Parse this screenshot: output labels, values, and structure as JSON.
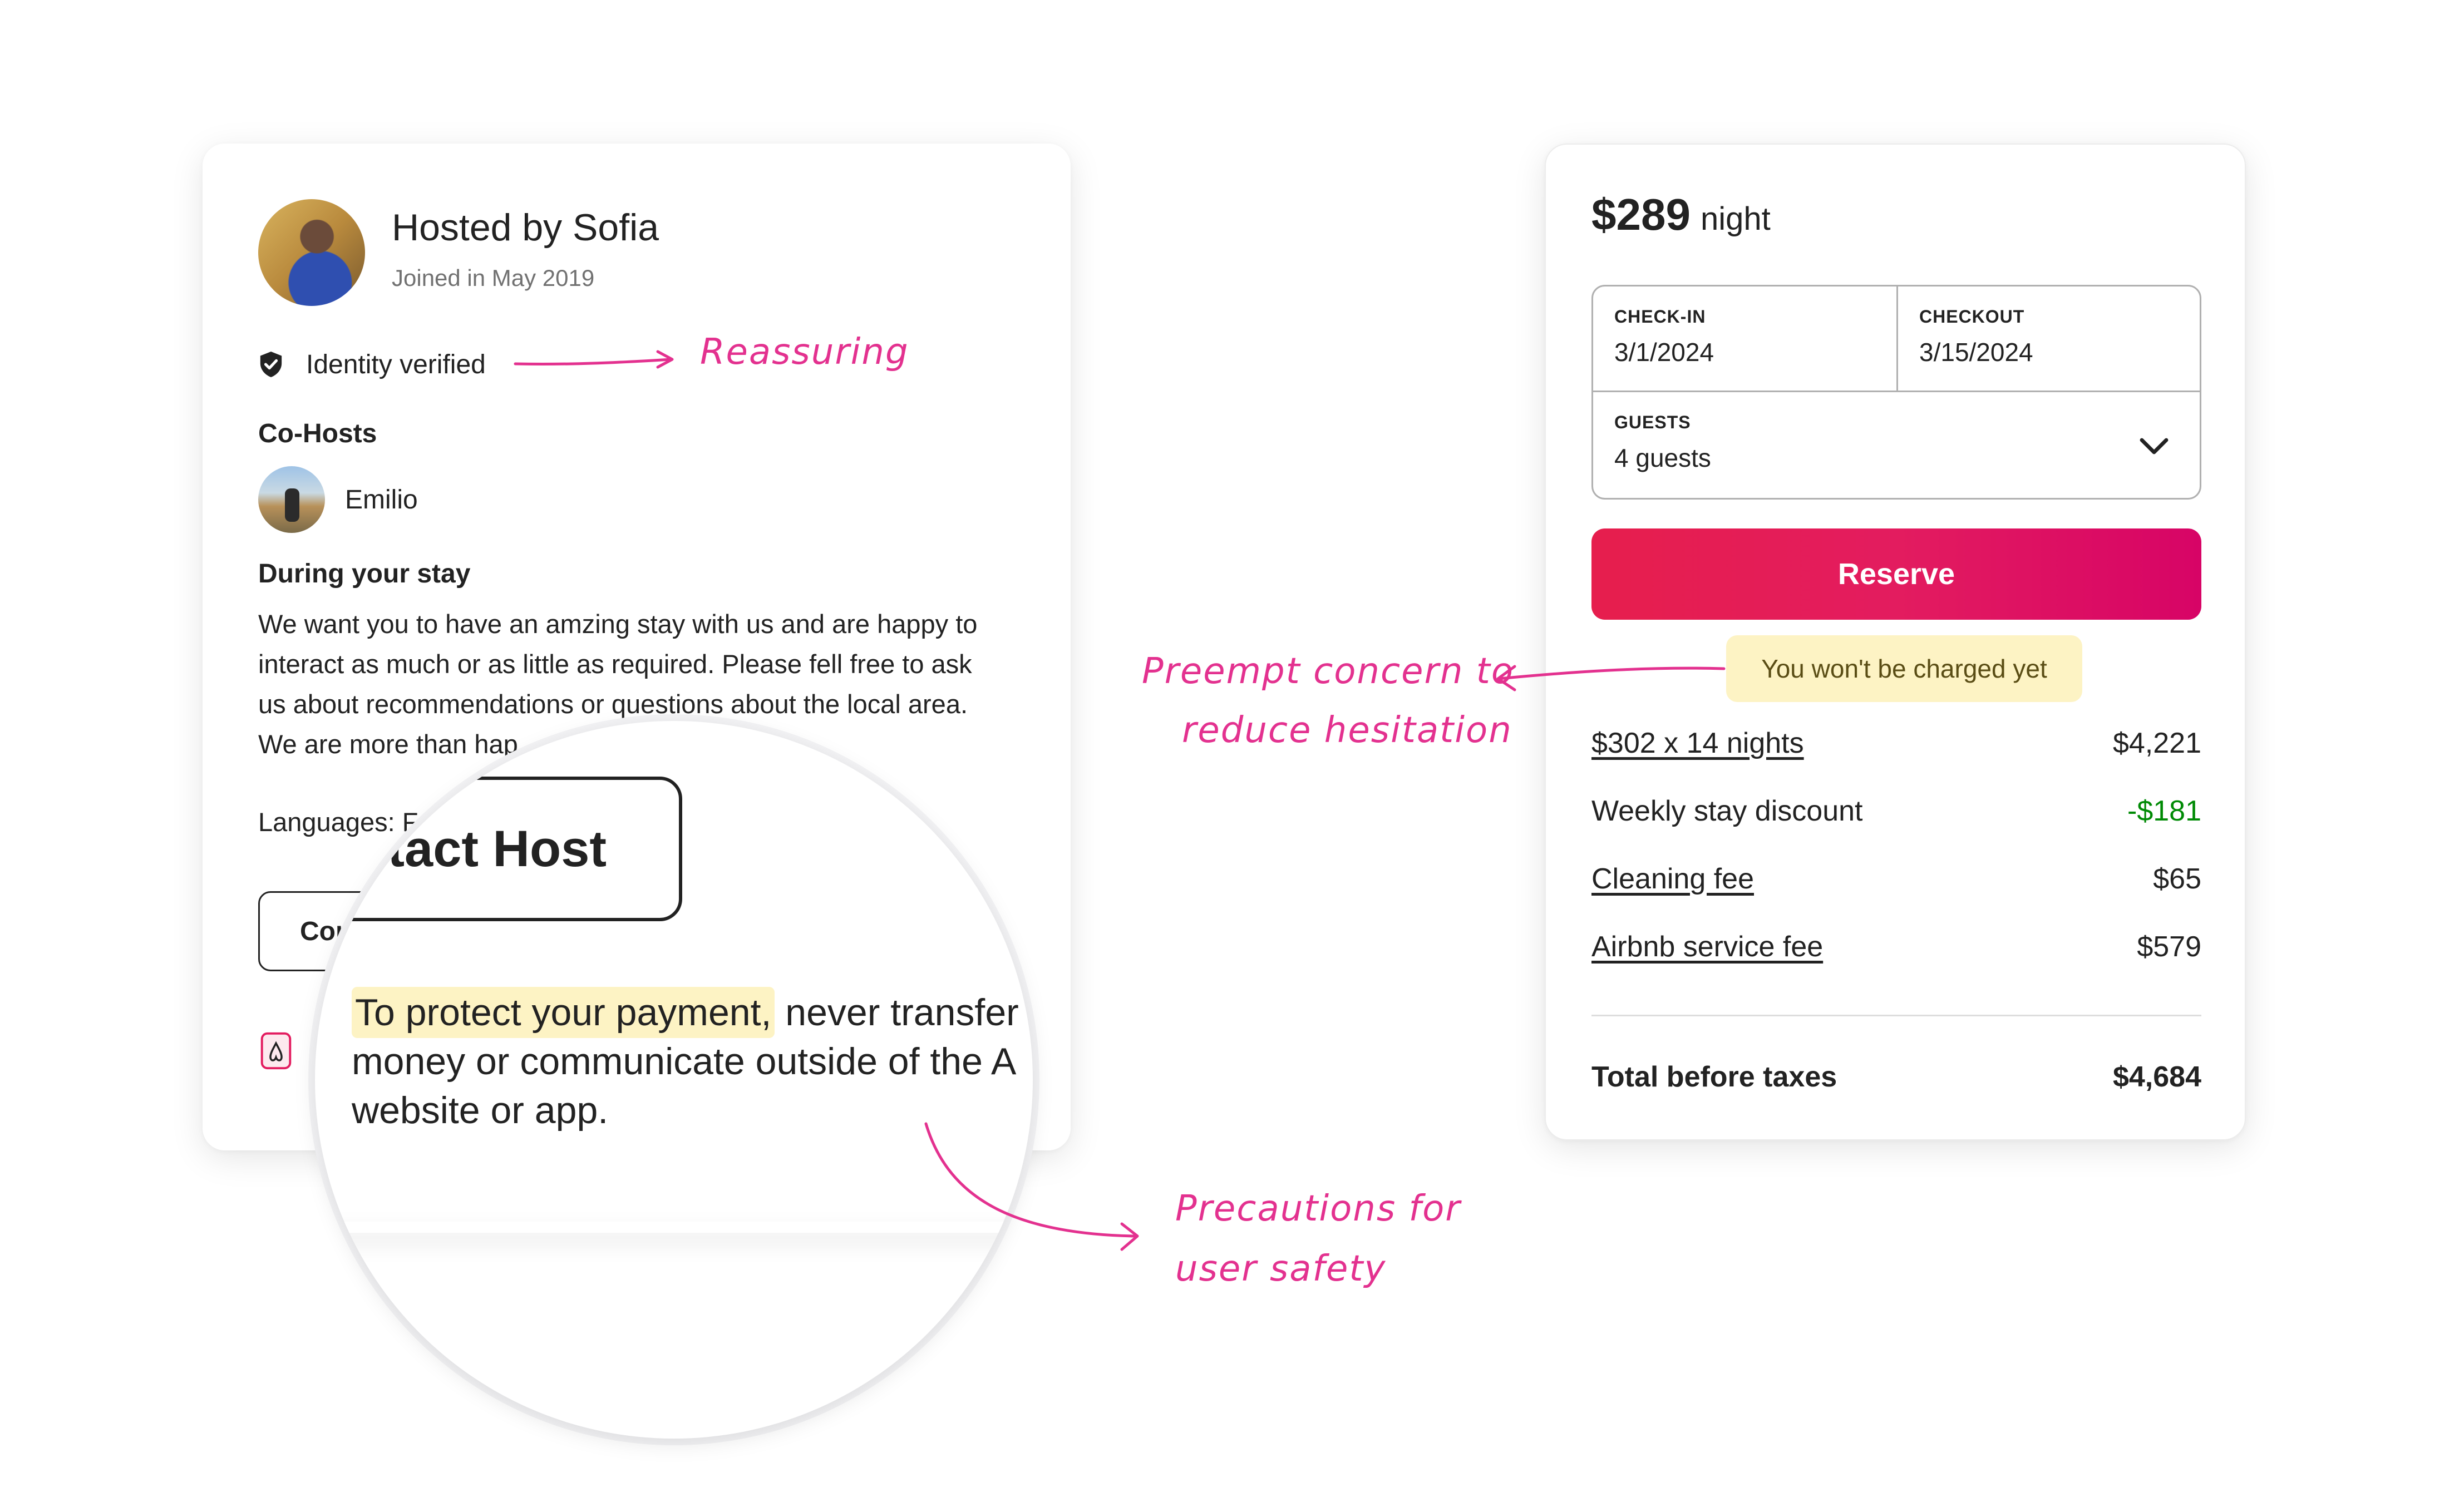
{
  "host_card": {
    "title": "Hosted by Sofia",
    "joined": "Joined in May 2019",
    "identity_verified": "Identity verified",
    "cohosts_heading": "Co-Hosts",
    "cohost_name": "Emilio",
    "stay_heading": "During your stay",
    "stay_text_line1": "We want you to have an amzing stay with us and are happy to",
    "stay_text_line2": "interact as much or as little as required. Please fell free to ask",
    "stay_text_line3": "us about recommendations or questions about the local area.",
    "stay_text_line4": "We are more than hap",
    "languages": "Languages: F",
    "contact_button_partial": "Cor",
    "icon": "airbnb-logo-icon"
  },
  "magnifier": {
    "contact_button_label": "tact Host",
    "payment_highlight": "To protect your payment,",
    "payment_line1_rest": " never transfer",
    "payment_line2": "money or communicate outside of the A",
    "payment_line3": "website or app."
  },
  "booking_card": {
    "price": "$289",
    "per_unit": "night",
    "checkin_label": "CHECK-IN",
    "checkin_value": "3/1/2024",
    "checkout_label": "CHECKOUT",
    "checkout_value": "3/15/2024",
    "guests_label": "GUESTS",
    "guests_value": "4 guests",
    "reserve_label": "Reserve",
    "charge_note": "You won't be charged yet",
    "line_items": [
      {
        "label": "$302 x 14 nights",
        "amount": "$4,221"
      },
      {
        "label": "Weekly stay discount",
        "amount": "-$181"
      },
      {
        "label": "Cleaning fee",
        "amount": "$65"
      },
      {
        "label": "Airbnb service fee",
        "amount": "$579"
      }
    ],
    "total_label": "Total before taxes",
    "total_amount": "$4,684",
    "colors": {
      "reserve_start": "#e61e4d",
      "reserve_end": "#d70466",
      "discount": "#008a05",
      "highlight": "#fdf3c4"
    }
  },
  "annotations": {
    "reassuring": "Reassuring",
    "preempt_line1": "Preempt concern to",
    "preempt_line2": "reduce hesitation",
    "precautions_line1": "Precautions for",
    "precautions_line2": "user safety",
    "color": "#e3318f"
  }
}
